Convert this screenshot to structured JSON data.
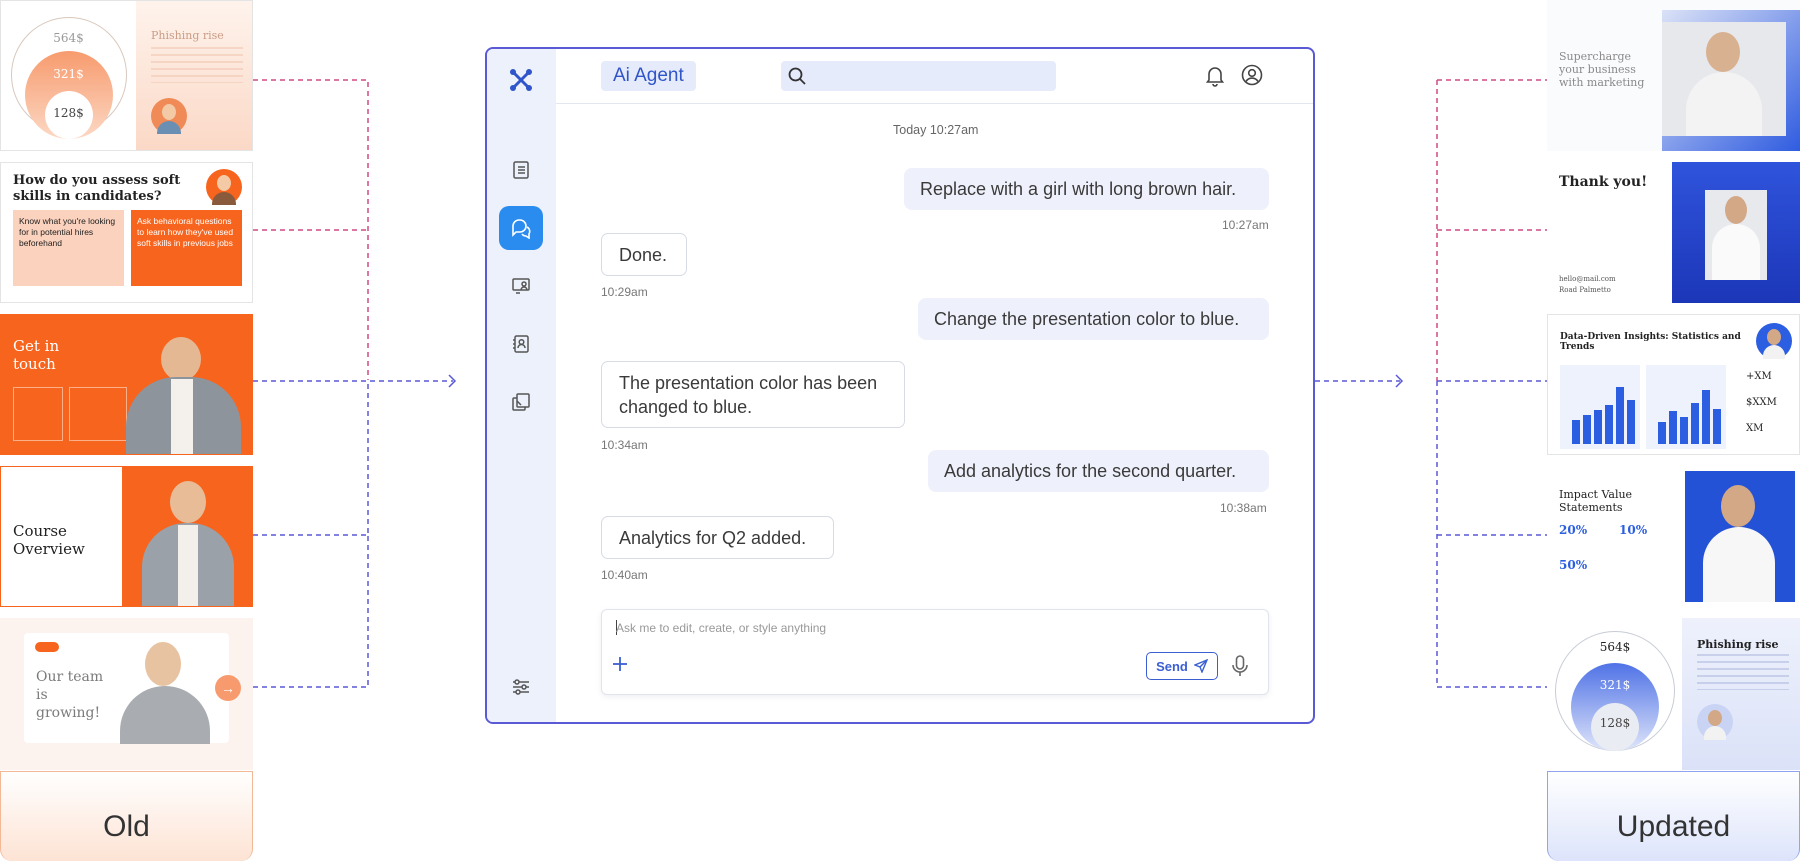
{
  "labels": {
    "old": "Old",
    "updated": "Updated"
  },
  "old_slides": {
    "phishing": {
      "v1": "564$",
      "v2": "321$",
      "v3": "128$",
      "title": "Phishing rise"
    },
    "soft_skills": {
      "question": "How do you assess soft skills in candidates?",
      "card1": "Know what you're looking for in potential hires beforehand",
      "card2": "Ask behavioral questions to learn how they've used soft skills in previous jobs"
    },
    "contact": {
      "title": "Get in touch"
    },
    "course": {
      "title": "Course Overview"
    },
    "team": {
      "title": "Our team is growing!"
    }
  },
  "new_slides": {
    "marketing": {
      "title": "Supercharge your business with marketing"
    },
    "thanks": {
      "title": "Thank you!",
      "email": "hello@mail.com",
      "address": "Road Palmetto"
    },
    "analytics": {
      "title": "Data-Driven Insights: Statistics and Trends",
      "s1": "+XM",
      "s2": "$XXM",
      "s3": "XM"
    },
    "impact": {
      "title": "Impact Value Statements",
      "p1": "20%",
      "p2": "10%",
      "p3": "50%"
    },
    "phishing": {
      "v1": "564$",
      "v2": "321$",
      "v3": "128$",
      "title": "Phishing rise"
    }
  },
  "app": {
    "title": "Ai Agent",
    "search_placeholder": "",
    "date_header": "Today 10:27am",
    "messages": [
      {
        "from": "user",
        "text": "Replace with a girl with long brown hair.",
        "time": "10:27am"
      },
      {
        "from": "bot",
        "text": "Done.",
        "time": "10:29am"
      },
      {
        "from": "user",
        "text": "Change the presentation color to blue.",
        "time": ""
      },
      {
        "from": "bot",
        "text": "The presentation color has been changed to blue.",
        "time": "10:34am"
      },
      {
        "from": "user",
        "text": "Add analytics for the second quarter.",
        "time": "10:38am"
      },
      {
        "from": "bot",
        "text": "Analytics for Q2 added.",
        "time": "10:40am"
      }
    ],
    "composer": {
      "placeholder": "Ask me to edit, create, or style anything",
      "send_label": "Send"
    }
  },
  "colors": {
    "accent": "#2b8cf0",
    "brand_blue": "#3b5fd1",
    "orange": "#f7641e",
    "window_border": "#5a59d6"
  },
  "icons": [
    "logo-icon",
    "document-icon",
    "chat-icon",
    "presentation-icon",
    "contacts-icon",
    "pages-icon",
    "settings-sliders-icon",
    "search-icon",
    "bell-icon",
    "user-icon",
    "plus-icon",
    "send-icon",
    "microphone-icon",
    "arrow-right-icon"
  ]
}
